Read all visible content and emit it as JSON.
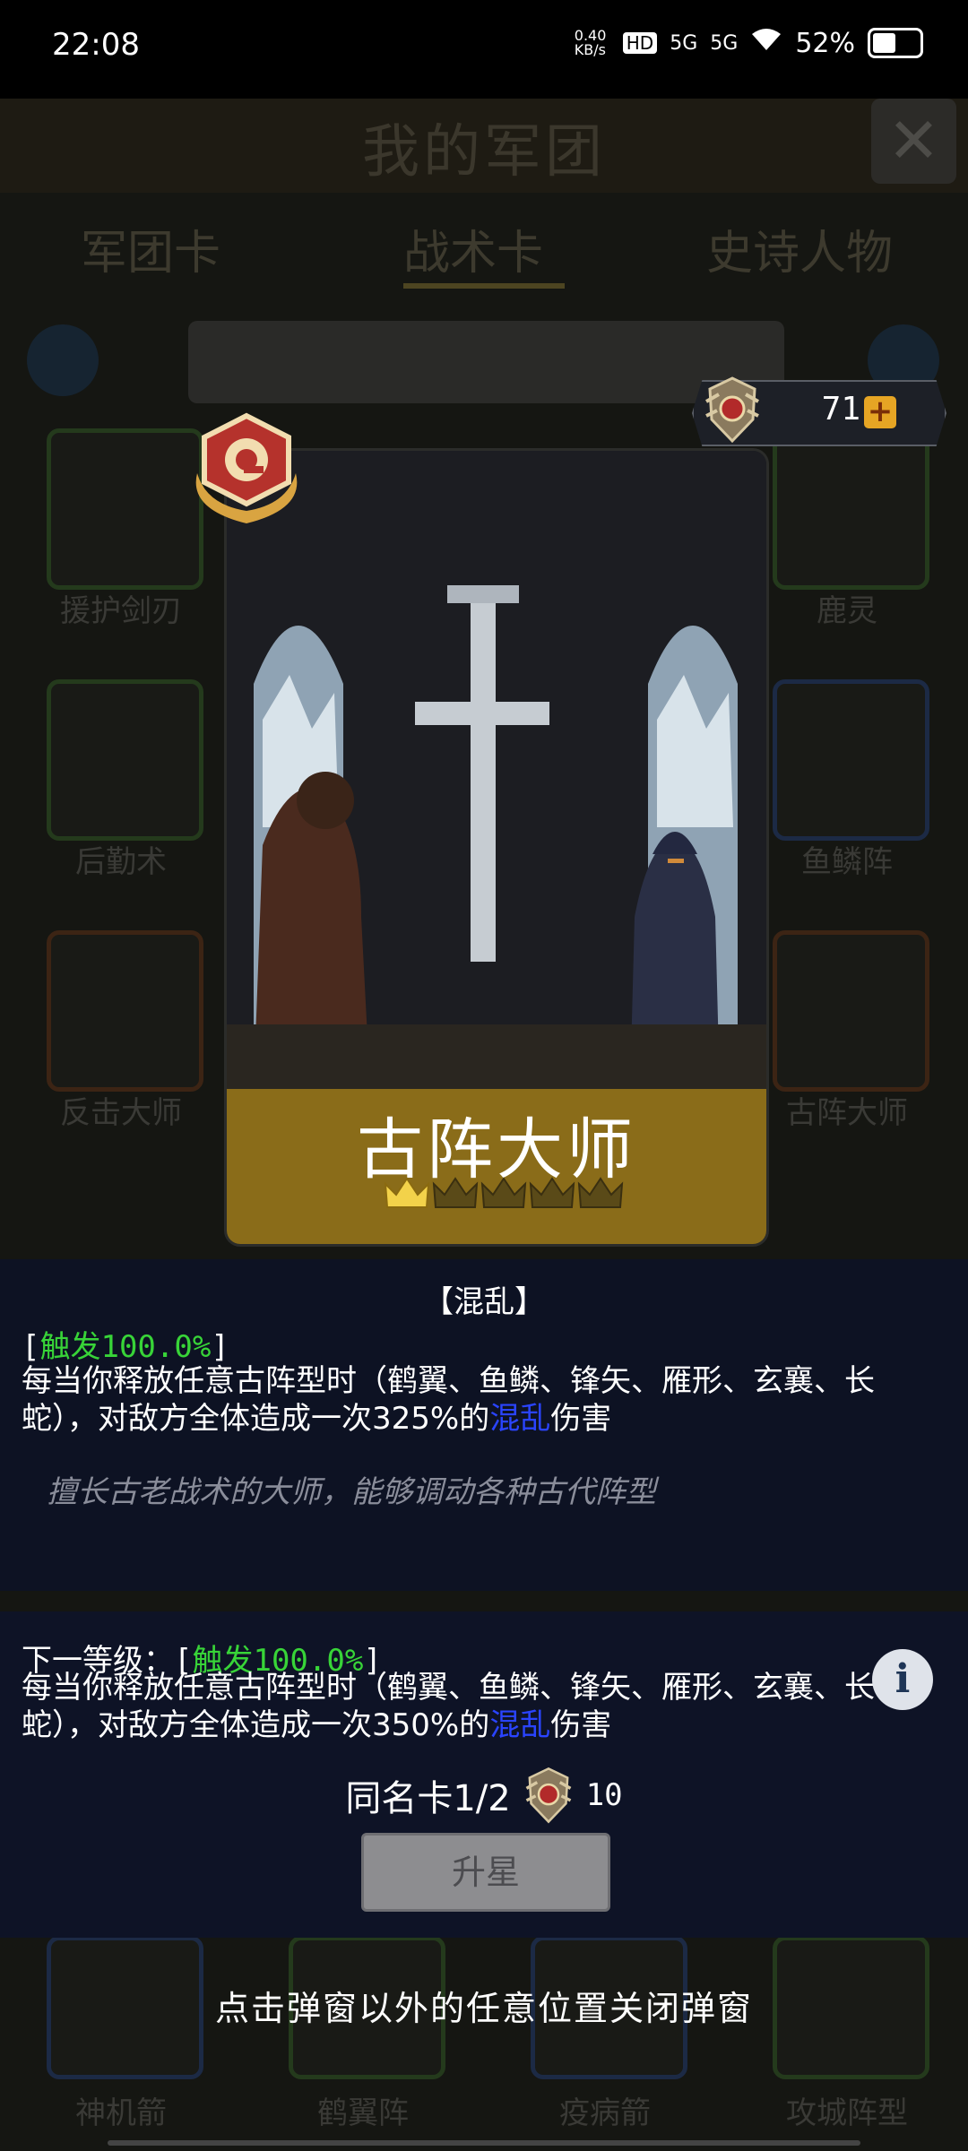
{
  "status_bar": {
    "time": "22:08",
    "net_speed": "0.40 KB/s",
    "hd": "HD",
    "signal_1": "5G",
    "signal_2": "5G",
    "battery": "52%"
  },
  "background": {
    "title": "我的军团",
    "tabs": [
      "军团卡",
      "战术卡",
      "史诗人物"
    ],
    "active_tab": "战术卡",
    "card_labels": [
      "援护剑刃",
      "鹿灵",
      "后勤术",
      "鱼鳞阵",
      "反击大师",
      "古阵大师",
      "神机箭",
      "鹤翼阵",
      "疫病箭",
      "攻城阵型"
    ]
  },
  "currency": {
    "count": "71",
    "plus": "+"
  },
  "card": {
    "name": "古阵大师",
    "stars_filled": 1,
    "stars_total": 5
  },
  "description": {
    "keyword": "【混乱】",
    "trigger_open": "[",
    "trigger": "触发100.0%",
    "trigger_close": "]",
    "effect_pre": "每当你释放任意古阵型时（鹤翼、鱼鳞、锋矢、雁形、玄襄、长蛇），对敌方全体造成一次325%的",
    "effect_keyword": "混乱",
    "effect_post": "伤害",
    "flavor": "擅长古老战术的大师，能够调动各种古代阵型"
  },
  "next_level": {
    "label": "下一等级：[",
    "trigger": "触发100.0%",
    "trigger_close": "]",
    "effect_pre": "每当你释放任意古阵型时（鹤翼、鱼鳞、锋矢、雁形、玄襄、长蛇），对敌方全体造成一次350%的",
    "effect_keyword": "混乱",
    "effect_post": "伤害"
  },
  "duplicate": {
    "label": "同名卡1/2",
    "cost": "10"
  },
  "upgrade_button": "升星",
  "info_icon": "i",
  "close_hint": "点击弹窗以外的任意位置关闭弹窗",
  "colors": {
    "trigger_green": "#38d438",
    "keyword_blue": "#2a44ff",
    "card_band": "#8a6c19",
    "panel_bg": "#0d1223"
  }
}
